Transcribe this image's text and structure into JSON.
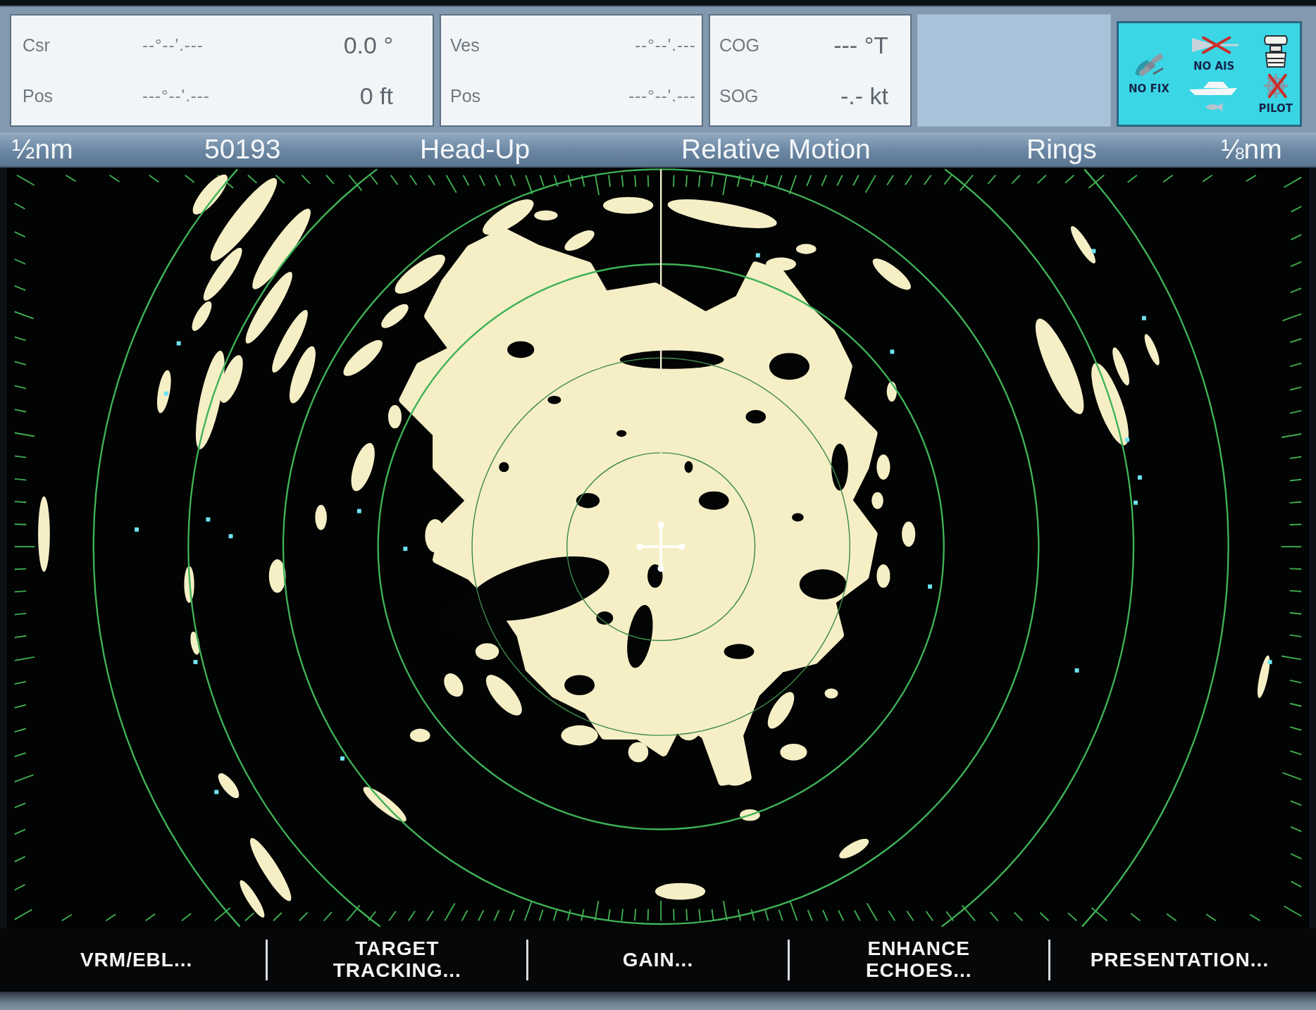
{
  "data_panels": [
    {
      "rows": [
        {
          "label": "Csr",
          "position": "--°--'.---",
          "value": "0.0 °"
        },
        {
          "label": "Pos",
          "position": "---°--'.---",
          "value": "0 ft"
        }
      ]
    },
    {
      "rows": [
        {
          "label": "Ves",
          "position": "--°--'.---"
        },
        {
          "label": "Pos",
          "position": "---°--'.---"
        }
      ]
    },
    {
      "rows": [
        {
          "label": "COG",
          "value": "--- °T"
        },
        {
          "label": "SOG",
          "value": "-.- kt"
        }
      ]
    }
  ],
  "status_panel": {
    "columns": [
      {
        "icons": [
          {
            "kind": "satellite",
            "label": "NO FIX",
            "crossed": false
          }
        ]
      },
      {
        "icons": [
          {
            "kind": "target",
            "label": "NO AIS",
            "crossed": true
          },
          {
            "kind": "boat",
            "crossed": false
          },
          {
            "kind": "fish",
            "crossed": false
          }
        ]
      },
      {
        "icons": [
          {
            "kind": "scanner",
            "crossed": false
          },
          {
            "kind": "helm",
            "label": "PILOT",
            "crossed": true
          }
        ]
      }
    ]
  },
  "status_bar": [
    "½nm",
    "50193",
    "Head-Up",
    "Relative Motion",
    "Rings",
    "⅛nm"
  ],
  "soft_keys": [
    "VRM/EBL...",
    "TARGET\nTRACKING...",
    "GAIN...",
    "ENHANCE\nECHOES...",
    "PRESENTATION..."
  ]
}
